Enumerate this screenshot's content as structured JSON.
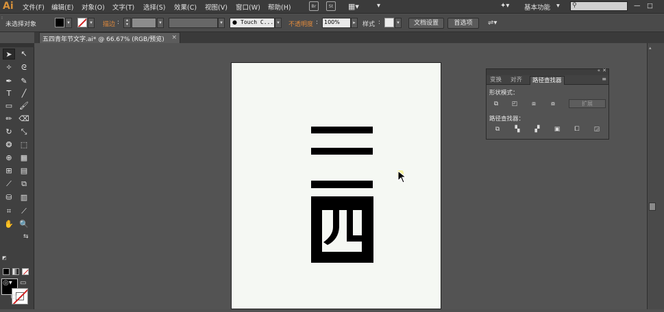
{
  "app": {
    "logo": "Ai"
  },
  "menubar": {
    "items": [
      "文件(F)",
      "编辑(E)",
      "对象(O)",
      "文字(T)",
      "选择(S)",
      "效果(C)",
      "视图(V)",
      "窗口(W)",
      "帮助(H)"
    ],
    "br_label": "Br",
    "st_label": "St",
    "workspace": "基本功能",
    "search_placeholder": ""
  },
  "controlbar": {
    "selection_status": "未选择对象",
    "stroke_label": "描边",
    "brush_name": "Touch C...",
    "opacity_label": "不透明度",
    "opacity_value": "100%",
    "style_label": "样式",
    "doc_setup_button": "文档设置",
    "prefs_button": "首选项"
  },
  "document": {
    "tab_title": "五四青年节文字.ai* @ 66.67% (RGB/预览)",
    "close": "×"
  },
  "pathfinder_panel": {
    "tabs": [
      "变换",
      "对齐",
      "路径查找器"
    ],
    "shape_modes_label": "形状模式：",
    "expand_button": "扩展",
    "pathfinders_label": "路径查找器："
  },
  "colors": {
    "accent": "#d7913a",
    "artboard": "#f5f8f3",
    "ink": "#000000"
  }
}
